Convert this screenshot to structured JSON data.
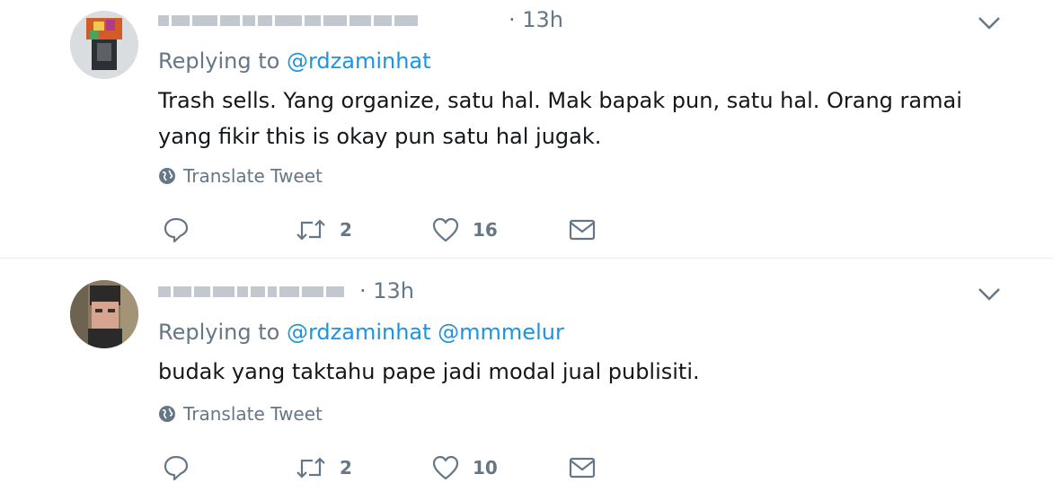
{
  "tweets": [
    {
      "time": "· 13h",
      "replying_prefix": "Replying to",
      "mentions": [
        "@rdzaminhat"
      ],
      "text": "Trash sells. Yang organize, satu hal. Mak bapak pun, satu hal. Orang ramai yang fikir this is okay pun satu hal jugak.",
      "translate_label": "Translate Tweet",
      "retweets": "2",
      "likes": "16"
    },
    {
      "time": "· 13h",
      "replying_prefix": "Replying to",
      "mentions": [
        "@rdzaminhat",
        "@mmmelur"
      ],
      "text": "budak yang taktahu pape jadi modal jual publisiti.",
      "translate_label": "Translate Tweet",
      "retweets": "2",
      "likes": "10"
    }
  ],
  "colors": {
    "text": "#14171a",
    "muted": "#657786",
    "link": "#1b95e0",
    "divider": "#e6ecf0"
  },
  "icons": [
    "reply-icon",
    "retweet-icon",
    "like-icon",
    "direct-message-icon",
    "globe-icon",
    "chevron-down-icon"
  ]
}
